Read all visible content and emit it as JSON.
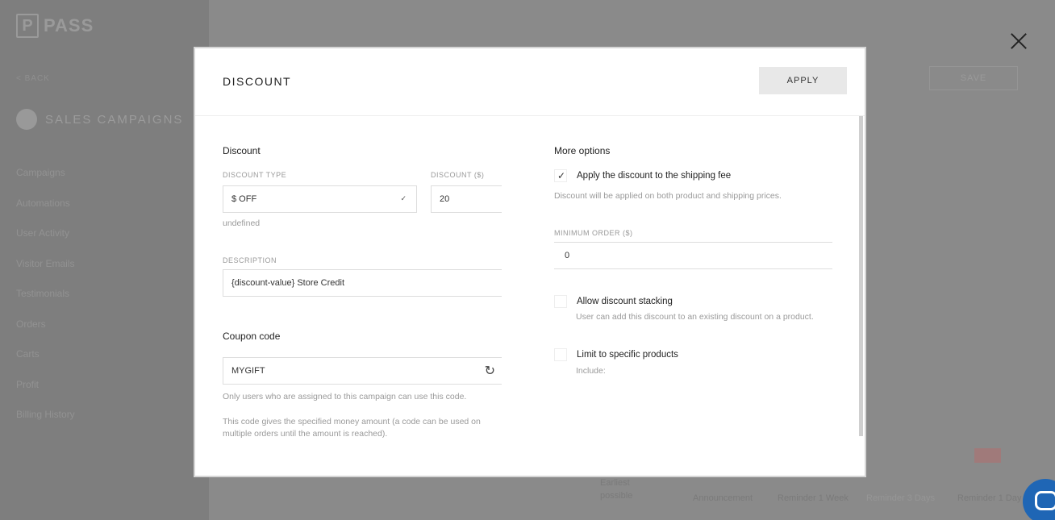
{
  "background": {
    "logo_letter": "P",
    "logo_text": "PASS",
    "back_label": "< BACK",
    "section_title": "SALES CAMPAIGNS",
    "nav": [
      "Campaigns",
      "Automations",
      "User Activity",
      "Visitor Emails",
      "Testimonials",
      "Orders",
      "Carts",
      "Profit",
      "Billing History"
    ],
    "save_label": "SAVE",
    "timeline": {
      "earliest_line1": "Earliest",
      "earliest_line2": "possible",
      "labels": [
        "Announcement",
        "Reminder 1 Week",
        "Reminder 3 Days",
        "Reminder 1 Day"
      ]
    }
  },
  "modal": {
    "title": "DISCOUNT",
    "apply_label": "APPLY",
    "discount": {
      "section_title": "Discount",
      "type_label": "DISCOUNT TYPE",
      "type_value": "$ OFF",
      "amount_label": "DISCOUNT ($)",
      "amount_value": "20",
      "undefined_text": "undefined",
      "description_label": "DESCRIPTION",
      "description_value": "{discount-value} Store Credit"
    },
    "coupon": {
      "section_title": "Coupon code",
      "code_value": "MYGIFT",
      "help1": "Only users who are assigned to this campaign can use this code.",
      "help2": "This code gives the specified money amount (a code can be used on multiple orders until the amount is reached)."
    },
    "more_options": {
      "section_title": "More options",
      "shipping_label": "Apply the discount to the shipping fee",
      "shipping_checked": true,
      "shipping_help": "Discount will be applied on both product and shipping prices.",
      "min_order_label": "MINIMUM ORDER ($)",
      "min_order_value": "0",
      "stacking_label": "Allow discount stacking",
      "stacking_checked": false,
      "stacking_help": "User can add this discount to an existing discount on a product.",
      "limit_label": "Limit to specific products",
      "limit_checked": false,
      "limit_help": "Include:"
    }
  }
}
